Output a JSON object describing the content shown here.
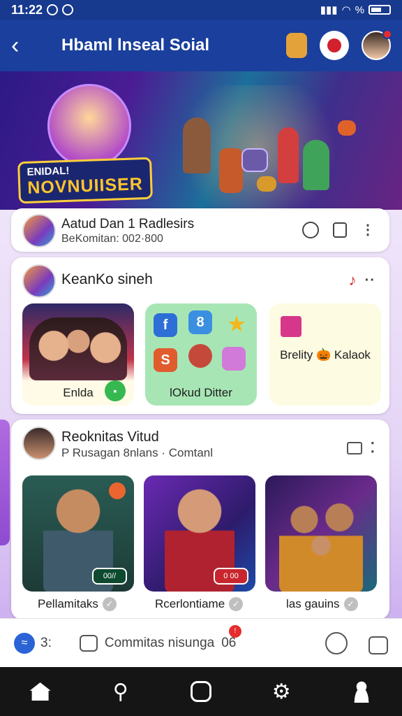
{
  "status_bar": {
    "time": "11:22",
    "battery_text": "%"
  },
  "app_bar": {
    "title": "Hbaml lnseal Soial"
  },
  "banner": {
    "logo_line1": "ENIDAL!",
    "logo_line2": "NOVNUIISER"
  },
  "post1": {
    "title": "Aatud Dan 1 Radlesirs",
    "subtitle": "BeKomitan: 002·800"
  },
  "community": {
    "title": "KeanKo sineh",
    "tiles": [
      {
        "label": "Enlda"
      },
      {
        "label": "lOkud Ditter"
      },
      {
        "label": "Brelity 🎃 Kalaok"
      }
    ]
  },
  "feed": {
    "title": "Reoknitas Vitud",
    "subtitle": "P Rusagan 8nlans · Comtanl",
    "photos": [
      {
        "caption": "Pellamitaks",
        "tag": "00//"
      },
      {
        "caption": "Rcerlontiame",
        "tag": "0 00"
      },
      {
        "caption": "las gauins",
        "tag": ""
      }
    ]
  },
  "bottom_strip": {
    "count": "3:",
    "comment_label": "Commitas nisunga",
    "comment_count": "06"
  },
  "icons": {
    "back": "back-arrow-icon",
    "comment": "comment-bubble-icon",
    "home": "home-icon",
    "search": "search-icon"
  },
  "colors": {
    "primary": "#1a3f9c",
    "accent": "#e52d2d",
    "nav": "#151515"
  }
}
